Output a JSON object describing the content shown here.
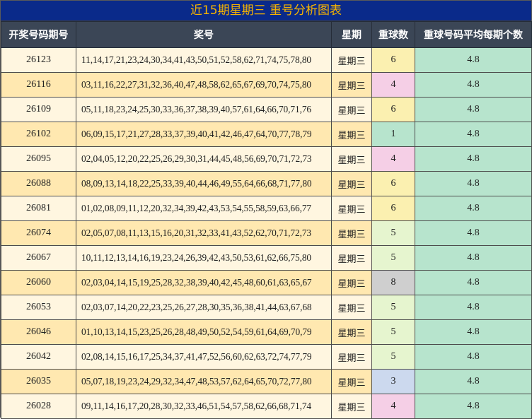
{
  "title": "近15期星期三 重号分析图表",
  "headers": {
    "issue": "开奖号码期号",
    "numbers": "奖号",
    "weekday": "星期",
    "repeat": "重球数",
    "avg": "重球号码平均每期个数"
  },
  "colors": {
    "title_bg": "#0a2a8a",
    "title_text": "#f6b400",
    "header_bg": "#3b4656",
    "avg_bg": "#b7e4cd",
    "repeat_scale": {
      "1": "#b7e4cd",
      "3": "#ccd9ee",
      "4": "#f5cfe6",
      "5": "#e6f5cf",
      "6": "#fbf0b0",
      "8": "#cfcfcf"
    }
  },
  "rows": [
    {
      "issue": "26123",
      "numbers": "11,14,17,21,23,24,30,34,41,43,50,51,52,58,62,71,74,75,78,80",
      "weekday": "星期三",
      "repeat": "6",
      "avg": "4.8"
    },
    {
      "issue": "26116",
      "numbers": "03,11,16,22,27,31,32,36,40,47,48,58,62,65,67,69,70,74,75,80",
      "weekday": "星期三",
      "repeat": "4",
      "avg": "4.8"
    },
    {
      "issue": "26109",
      "numbers": "05,11,18,23,24,25,30,33,36,37,38,39,40,57,61,64,66,70,71,76",
      "weekday": "星期三",
      "repeat": "6",
      "avg": "4.8"
    },
    {
      "issue": "26102",
      "numbers": "06,09,15,17,21,27,28,33,37,39,40,41,42,46,47,64,70,77,78,79",
      "weekday": "星期三",
      "repeat": "1",
      "avg": "4.8"
    },
    {
      "issue": "26095",
      "numbers": "02,04,05,12,20,22,25,26,29,30,31,44,45,48,56,69,70,71,72,73",
      "weekday": "星期三",
      "repeat": "4",
      "avg": "4.8"
    },
    {
      "issue": "26088",
      "numbers": "08,09,13,14,18,22,25,33,39,40,44,46,49,55,64,66,68,71,77,80",
      "weekday": "星期三",
      "repeat": "6",
      "avg": "4.8"
    },
    {
      "issue": "26081",
      "numbers": "01,02,08,09,11,12,20,32,34,39,42,43,53,54,55,58,59,63,66,77",
      "weekday": "星期三",
      "repeat": "6",
      "avg": "4.8"
    },
    {
      "issue": "26074",
      "numbers": "02,05,07,08,11,13,15,16,20,31,32,33,41,43,52,62,70,71,72,73",
      "weekday": "星期三",
      "repeat": "5",
      "avg": "4.8"
    },
    {
      "issue": "26067",
      "numbers": "10,11,12,13,14,16,19,23,24,26,39,42,43,50,53,61,62,66,75,80",
      "weekday": "星期三",
      "repeat": "5",
      "avg": "4.8"
    },
    {
      "issue": "26060",
      "numbers": "02,03,04,14,15,19,25,28,32,38,39,40,42,45,48,60,61,63,65,67",
      "weekday": "星期三",
      "repeat": "8",
      "avg": "4.8"
    },
    {
      "issue": "26053",
      "numbers": "02,03,07,14,20,22,23,25,26,27,28,30,35,36,38,41,44,63,67,68",
      "weekday": "星期三",
      "repeat": "5",
      "avg": "4.8"
    },
    {
      "issue": "26046",
      "numbers": "01,10,13,14,15,23,25,26,28,48,49,50,52,54,59,61,64,69,70,79",
      "weekday": "星期三",
      "repeat": "5",
      "avg": "4.8"
    },
    {
      "issue": "26042",
      "numbers": "02,08,14,15,16,17,25,34,37,41,47,52,56,60,62,63,72,74,77,79",
      "weekday": "星期三",
      "repeat": "5",
      "avg": "4.8"
    },
    {
      "issue": "26035",
      "numbers": "05,07,18,19,23,24,29,32,34,47,48,53,57,62,64,65,70,72,77,80",
      "weekday": "星期三",
      "repeat": "3",
      "avg": "4.8"
    },
    {
      "issue": "26028",
      "numbers": "09,11,14,16,17,20,28,30,32,33,46,51,54,57,58,62,66,68,71,74",
      "weekday": "星期三",
      "repeat": "4",
      "avg": "4.8"
    }
  ]
}
